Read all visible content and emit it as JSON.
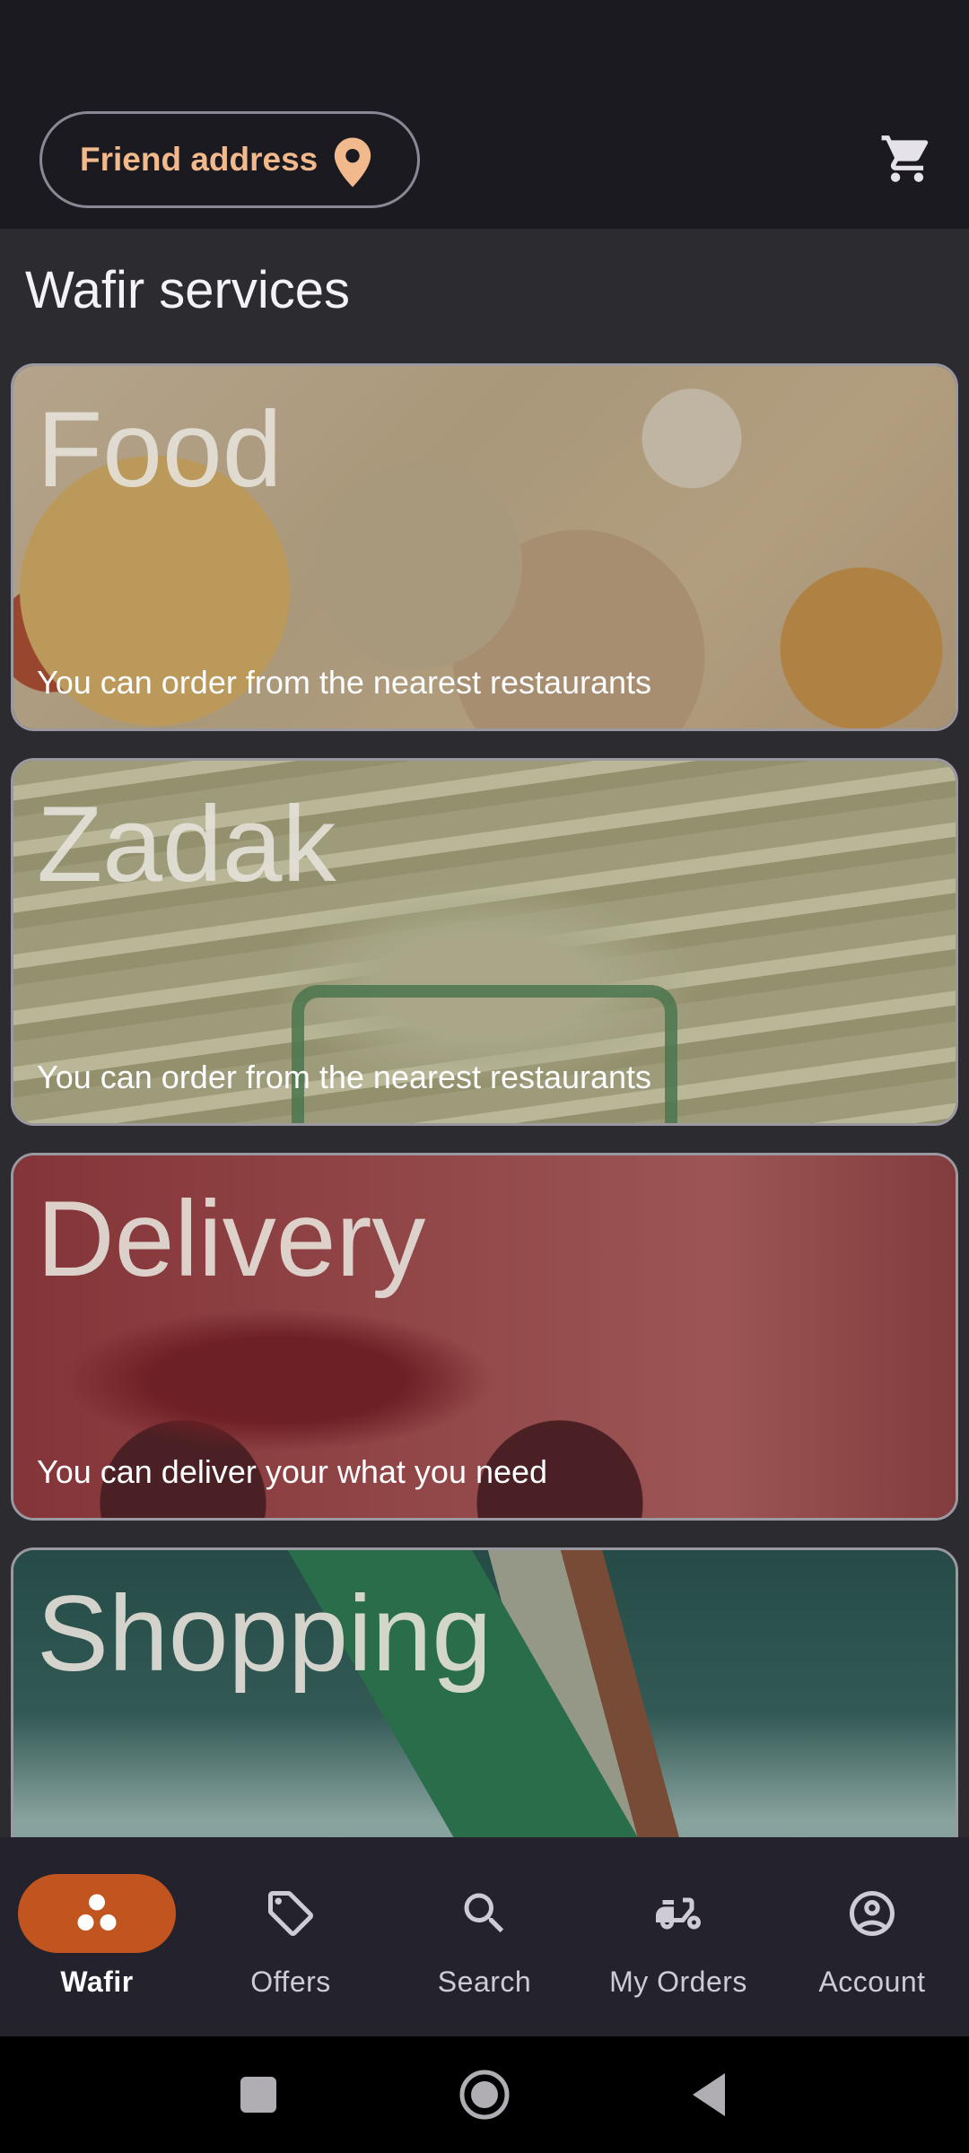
{
  "header": {
    "address_label": "Friend address",
    "address_icon": "location-pin-icon",
    "cart_icon": "shopping-cart-icon"
  },
  "main": {
    "section_title": "Wafir services",
    "services": [
      {
        "name": "Food",
        "description": "You can order from the nearest restaurants"
      },
      {
        "name": "Zadak",
        "description": "You can order from the nearest restaurants"
      },
      {
        "name": "Delivery",
        "description": "You can deliver your what you need"
      },
      {
        "name": "Shopping",
        "description": ""
      }
    ]
  },
  "bottom_nav": {
    "active": "Wafir",
    "items": [
      {
        "label": "Wafir",
        "icon": "wafir-dots-icon"
      },
      {
        "label": "Offers",
        "icon": "tag-icon"
      },
      {
        "label": "Search",
        "icon": "search-icon"
      },
      {
        "label": "My Orders",
        "icon": "scooter-icon"
      },
      {
        "label": "Account",
        "icon": "account-circle-icon"
      }
    ]
  },
  "system_nav": {
    "buttons": [
      "recents-button",
      "home-button",
      "back-button"
    ]
  },
  "colors": {
    "accent": "#c2541f",
    "address_text": "#f2b98c",
    "app_bar": "#1b1a20",
    "content_bg": "#2c2b2f",
    "nav_bg": "#24232d"
  }
}
